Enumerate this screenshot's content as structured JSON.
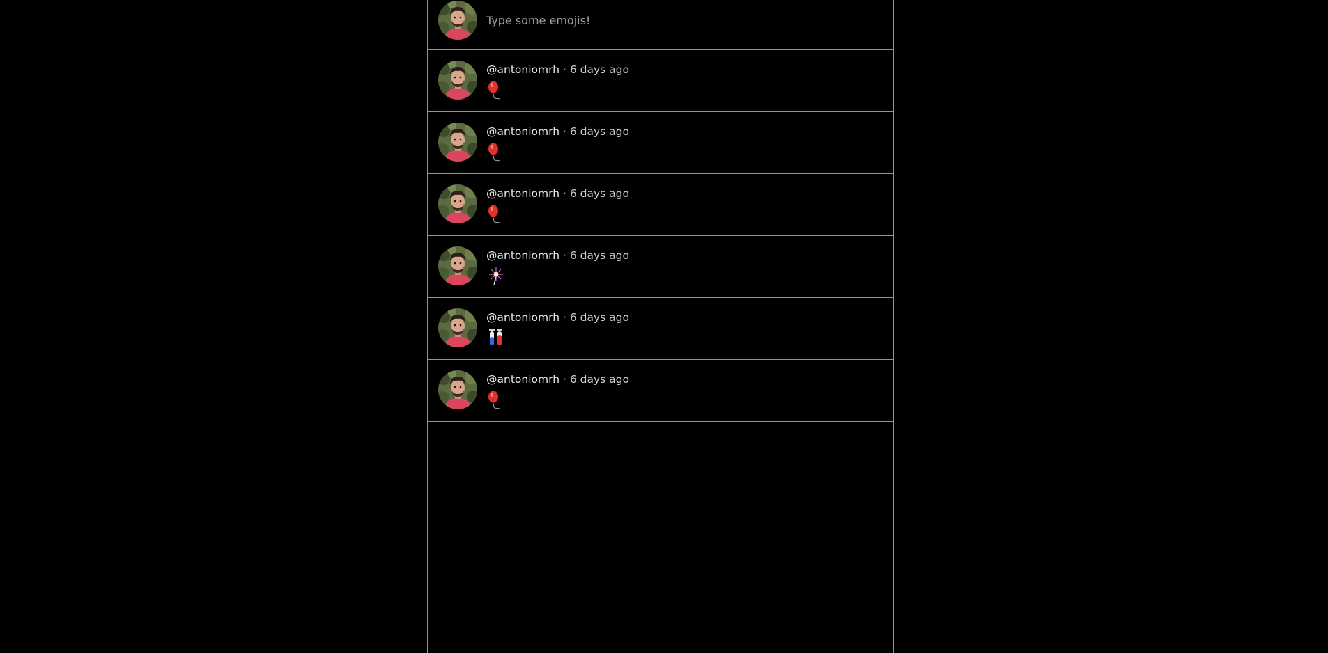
{
  "composer": {
    "placeholder": "Type some emojis!"
  },
  "posts": [
    {
      "author": "@antoniomrh",
      "separator": " · ",
      "time": "6 days ago",
      "emoji": "balloon"
    },
    {
      "author": "@antoniomrh",
      "separator": " · ",
      "time": "6 days ago",
      "emoji": "balloon"
    },
    {
      "author": "@antoniomrh",
      "separator": " · ",
      "time": "6 days ago",
      "emoji": "balloon"
    },
    {
      "author": "@antoniomrh",
      "separator": " · ",
      "time": "6 days ago",
      "emoji": "sparkler"
    },
    {
      "author": "@antoniomrh",
      "separator": " · ",
      "time": "6 days ago",
      "emoji": "test-tubes"
    },
    {
      "author": "@antoniomrh",
      "separator": " · ",
      "time": "6 days ago",
      "emoji": "balloon"
    }
  ],
  "colors": {
    "background": "#000000",
    "border": "#8b93a8",
    "author": "#e6e8ec",
    "muted": "#9aa1ad"
  }
}
